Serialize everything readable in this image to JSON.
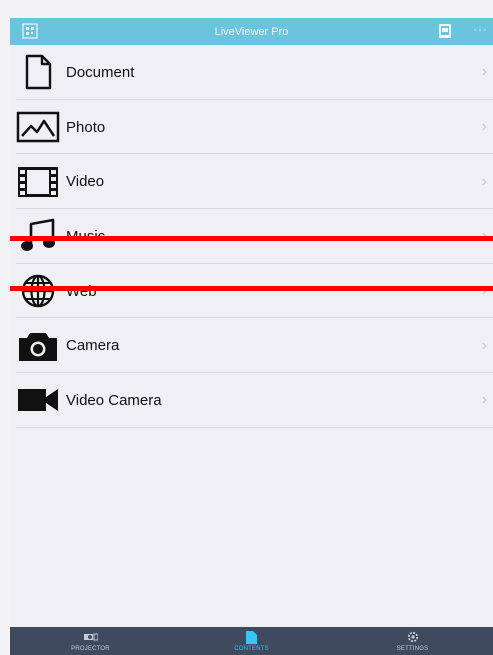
{
  "header": {
    "title": "LiveViewer Pro",
    "more": "···"
  },
  "menu": {
    "items": [
      {
        "label": "Document",
        "icon": "document-icon"
      },
      {
        "label": "Photo",
        "icon": "photo-icon"
      },
      {
        "label": "Video",
        "icon": "film-icon"
      },
      {
        "label": "Music",
        "icon": "music-note-icon",
        "selected": true
      },
      {
        "label": "Web",
        "icon": "globe-icon"
      },
      {
        "label": "Camera",
        "icon": "camera-icon"
      },
      {
        "label": "Video Camera",
        "icon": "video-camera-icon"
      }
    ],
    "chevron": "›"
  },
  "tabbar": {
    "tabs": [
      {
        "label": "PROJECTOR",
        "icon": "projector-icon"
      },
      {
        "label": "CONTENTS",
        "icon": "contents-icon",
        "active": true
      },
      {
        "label": "SETTINGS",
        "icon": "settings-icon"
      }
    ]
  },
  "colors": {
    "header_bg": "#6cc3dd",
    "tabbar_bg": "#3f4a5e",
    "active_tab": "#35c6f4",
    "highlight": "#ff0000"
  }
}
